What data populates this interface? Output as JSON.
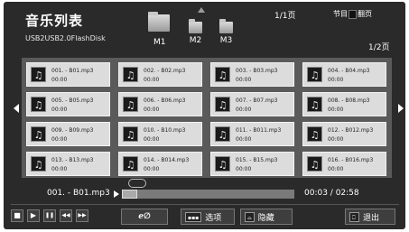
{
  "header": {
    "title": "音乐列表",
    "path": "USB2USB2.0FlashDisk",
    "folders": [
      "",
      "M1",
      "M2",
      "M3"
    ],
    "page_top": "1/1页",
    "legend_label1": "节目",
    "legend_label2": "翻页",
    "page_right": "1/2页"
  },
  "tiles": [
    {
      "name": "001. - B01.mp3",
      "time": "00:00"
    },
    {
      "name": "002. - B02.mp3",
      "time": "00:00"
    },
    {
      "name": "003. - B03.mp3",
      "time": "00:00"
    },
    {
      "name": "004. - B04.mp3",
      "time": "00:00"
    },
    {
      "name": "005. - B05.mp3",
      "time": "00:00"
    },
    {
      "name": "006. - B06.mp3",
      "time": "00:00"
    },
    {
      "name": "007. - B07.mp3",
      "time": "00:00"
    },
    {
      "name": "008. - B08.mp3",
      "time": "00:00"
    },
    {
      "name": "009. - B09.mp3",
      "time": "00:00"
    },
    {
      "name": "010. - B10.mp3",
      "time": "00:00"
    },
    {
      "name": "011. - B011.mp3",
      "time": "00:00"
    },
    {
      "name": "012. - B012.mp3",
      "time": "00:00"
    },
    {
      "name": "013. - B13.mp3",
      "time": "00:00"
    },
    {
      "name": "014. - B014.mp3",
      "time": "00:00"
    },
    {
      "name": "015. - B15.mp3",
      "time": "00:00"
    },
    {
      "name": "016. - B016.mp3",
      "time": "00:00"
    }
  ],
  "player": {
    "now_playing": "001. - B01.mp3",
    "time": "00:03 / 02:58",
    "progress": 0.09
  },
  "controls": {
    "stop_icon": "■",
    "play_icon": "▶",
    "pause_icon": "❚❚",
    "rewind_icon": "◀◀",
    "forward_icon": "▶▶",
    "loop_symbol": "ℯ∅",
    "options_label": "选项",
    "hide_label": "隐藏",
    "exit_label": "退出"
  },
  "colors": {
    "panel": "#2a2a2a",
    "grid_bg": "#5a5a5a",
    "tile": "#dcdcdc"
  }
}
